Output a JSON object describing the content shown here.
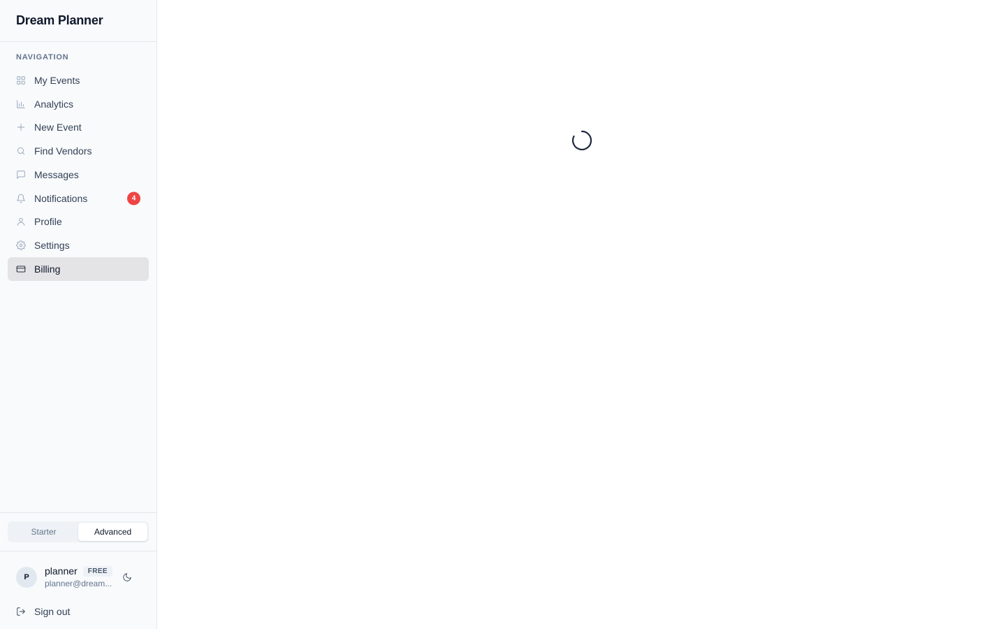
{
  "brand": {
    "title": "Dream Planner"
  },
  "sidebar": {
    "heading": "NAVIGATION",
    "items": [
      {
        "label": "My Events",
        "icon": "grid-icon"
      },
      {
        "label": "Analytics",
        "icon": "bar-chart-icon"
      },
      {
        "label": "New Event",
        "icon": "plus-icon"
      },
      {
        "label": "Find Vendors",
        "icon": "search-icon"
      },
      {
        "label": "Messages",
        "icon": "message-icon"
      },
      {
        "label": "Notifications",
        "icon": "bell-icon",
        "badge": "4"
      },
      {
        "label": "Profile",
        "icon": "user-icon"
      },
      {
        "label": "Settings",
        "icon": "gear-icon"
      },
      {
        "label": "Billing",
        "icon": "credit-card-icon",
        "active": true
      }
    ]
  },
  "mode_toggle": {
    "options": [
      "Starter",
      "Advanced"
    ],
    "selected": "Advanced"
  },
  "user": {
    "initial": "P",
    "name": "planner",
    "plan": "FREE",
    "email": "planner@dream..."
  },
  "signout": {
    "label": "Sign out"
  },
  "colors": {
    "accent": "#0f172a",
    "badge": "#ef4444",
    "active_bg": "#e4e4e7",
    "sidebar_bg": "#f8fafc"
  },
  "main": {
    "state": "loading",
    "spinner_icon": "loading-spinner-icon"
  }
}
